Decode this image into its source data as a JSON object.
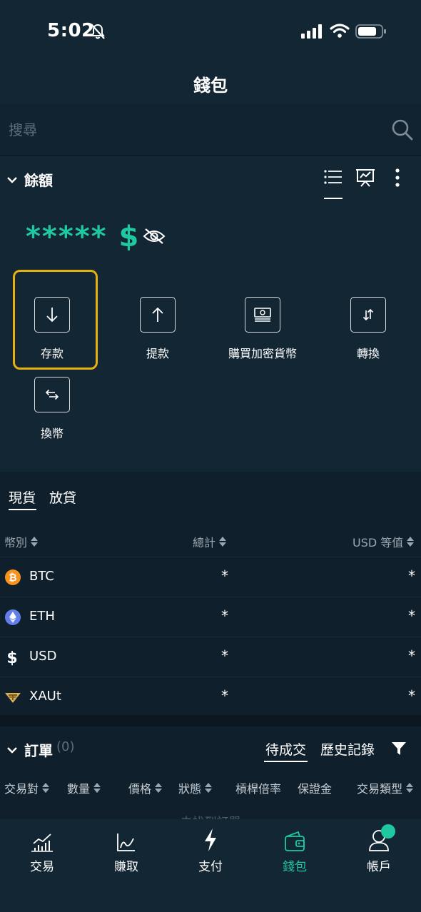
{
  "status": {
    "time": "5:02"
  },
  "header": {
    "title": "錢包"
  },
  "search": {
    "placeholder": "搜尋"
  },
  "balance": {
    "title": "餘額",
    "amount_masked": "*****",
    "currency_symbol": "$"
  },
  "actions": [
    {
      "label": "存款"
    },
    {
      "label": "提款"
    },
    {
      "label": "購買加密貨幣"
    },
    {
      "label": "轉換"
    },
    {
      "label": "換幣"
    }
  ],
  "assets_tabs": [
    "現貨",
    "放貸"
  ],
  "assets_columns": {
    "currency": "幣別",
    "total": "總計",
    "usd_value": "USD 等值"
  },
  "assets": [
    {
      "name": "BTC",
      "icon": "btc-icon",
      "total": "*",
      "usd": "*"
    },
    {
      "name": "ETH",
      "icon": "eth-icon",
      "total": "*",
      "usd": "*"
    },
    {
      "name": "USD",
      "icon": "usd-icon",
      "total": "*",
      "usd": "*"
    },
    {
      "name": "XAUt",
      "icon": "xaut-icon",
      "total": "*",
      "usd": "*"
    }
  ],
  "orders": {
    "title": "訂單",
    "count": "(0)",
    "tabs": [
      "待成交",
      "歷史記錄"
    ],
    "columns": [
      "交易對",
      "數量",
      "價格",
      "狀態",
      "槓桿倍率",
      "保證金",
      "交易類型"
    ],
    "empty_text": "未找到訂單"
  },
  "nav": [
    {
      "label": "交易",
      "icon": "trade-chart-icon"
    },
    {
      "label": "賺取",
      "icon": "earn-chart-icon"
    },
    {
      "label": "支付",
      "icon": "lightning-icon"
    },
    {
      "label": "錢包",
      "icon": "wallet-icon",
      "active": true
    },
    {
      "label": "帳戶",
      "icon": "account-icon"
    }
  ],
  "colors": {
    "accent": "#1fc8a0",
    "highlight": "#e6b10c",
    "background": "#0f1f2b",
    "panel": "#132633",
    "btc": "#f7931a",
    "eth": "#627eea",
    "xaut": "#d9b15a"
  }
}
